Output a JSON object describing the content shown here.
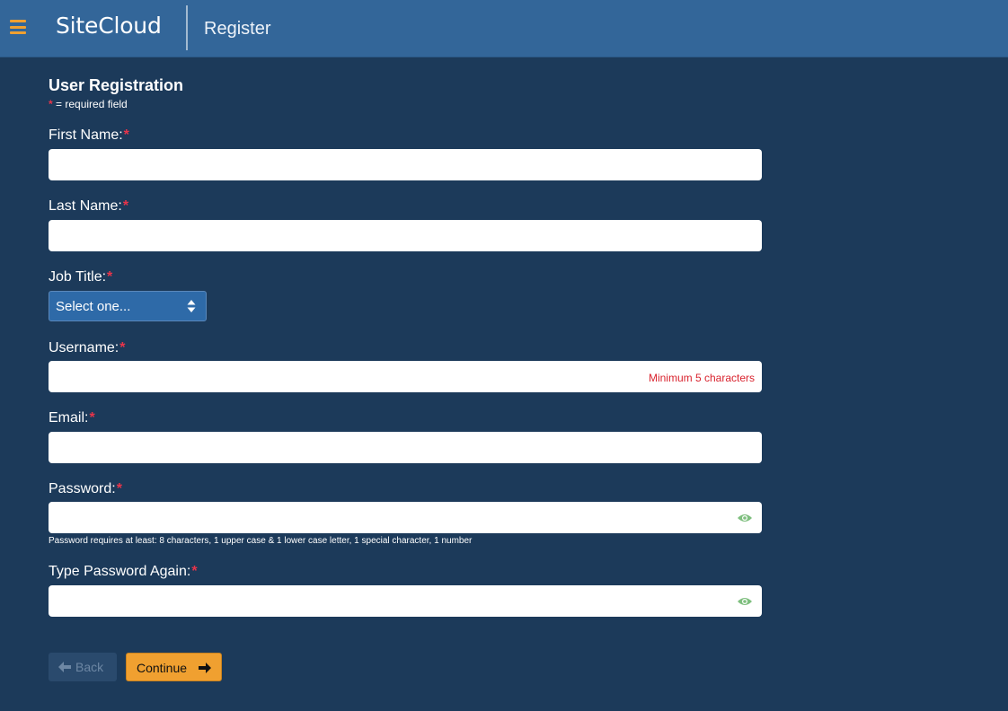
{
  "header": {
    "brand": "SiteCloud",
    "page": "Register",
    "menu_icon": "hamburger-menu-icon",
    "accent_color": "#f0a030",
    "bar_color": "#336699"
  },
  "form": {
    "title": "User Registration",
    "required_star": "*",
    "required_note": "= required field",
    "fields": {
      "first_name": {
        "label": "First Name:",
        "value": "",
        "placeholder": ""
      },
      "last_name": {
        "label": "Last Name:",
        "value": "",
        "placeholder": ""
      },
      "job_title": {
        "label": "Job Title:",
        "selected": "Select one..."
      },
      "username": {
        "label": "Username:",
        "value": "",
        "placeholder": "",
        "hint": "Minimum 5 characters"
      },
      "email": {
        "label": "Email:",
        "value": "",
        "placeholder": ""
      },
      "password": {
        "label": "Password:",
        "value": "",
        "placeholder": "",
        "hint": "Password requires at least: 8 characters, 1 upper case & 1 lower case letter, 1 special character, 1 number",
        "toggle_icon": "eye-icon"
      },
      "password_again": {
        "label": "Type Password Again:",
        "value": "",
        "placeholder": "",
        "toggle_icon": "eye-icon"
      }
    },
    "buttons": {
      "back": "Back",
      "continue": "Continue"
    }
  },
  "colors": {
    "background": "#1c3a5a",
    "required": "#e8344a",
    "error_hint": "#d9232e",
    "eye": "#7fbf7f"
  }
}
